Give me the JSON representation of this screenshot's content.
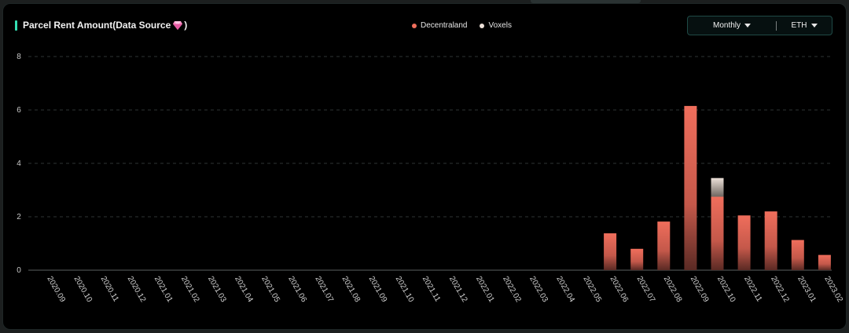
{
  "header": {
    "title": "Parcel Rent Amount(Data Source ",
    "title_suffix": ")"
  },
  "controls": {
    "period": "Monthly",
    "currency": "ETH"
  },
  "colors": {
    "accent": "#34e0b4",
    "decentraland": "#f06e5c",
    "voxels": "#ece0d8"
  },
  "chart_data": {
    "type": "bar",
    "stacked": true,
    "categories": [
      "2020.09",
      "2020.10",
      "2020.11",
      "2020.12",
      "2021.01",
      "2021.02",
      "2021.03",
      "2021.04",
      "2021.05",
      "2021.06",
      "2021.07",
      "2021.08",
      "2021.09",
      "2021.10",
      "2021.11",
      "2021.12",
      "2022.01",
      "2022.02",
      "2022.03",
      "2022.04",
      "2022.05",
      "2022.06",
      "2022.07",
      "2022.08",
      "2022.09",
      "2022.10",
      "2022.11",
      "2022.12",
      "2023.01",
      "2023.02"
    ],
    "series": [
      {
        "name": "Decentraland",
        "color": "#f06e5c",
        "values": [
          0,
          0,
          0,
          0,
          0,
          0,
          0,
          0,
          0,
          0,
          0,
          0,
          0,
          0,
          0,
          0,
          0,
          0,
          0,
          0,
          0,
          1.38,
          0.8,
          1.82,
          6.15,
          2.75,
          2.05,
          2.2,
          1.13,
          0.57
        ]
      },
      {
        "name": "Voxels",
        "color": "#ece0d8",
        "values": [
          0,
          0,
          0,
          0,
          0,
          0,
          0,
          0,
          0,
          0,
          0,
          0,
          0,
          0,
          0,
          0,
          0,
          0,
          0,
          0,
          0,
          0,
          0,
          0,
          0,
          0.7,
          0,
          0,
          0,
          0
        ]
      }
    ],
    "yticks": [
      0,
      2,
      4,
      6,
      8
    ],
    "ylim": [
      0,
      8
    ],
    "grid": true,
    "legend_position": "top-center"
  }
}
